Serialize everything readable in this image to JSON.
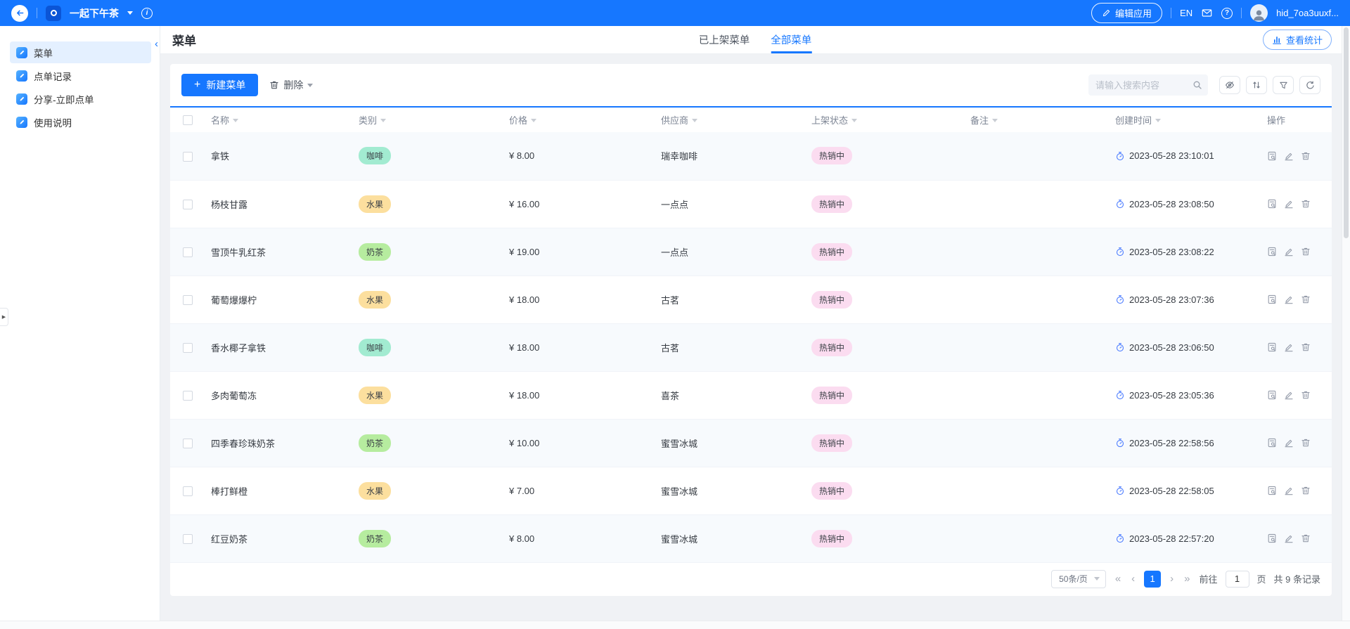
{
  "colors": {
    "primary": "#1677ff",
    "category": {
      "咖啡": "#a2ebd1",
      "水果": "#fcdf9e",
      "奶茶": "#b6ec9f"
    },
    "status": "#fbdcf0",
    "row_stripe": "#f7fafd"
  },
  "topbar": {
    "app_name": "一起下午茶",
    "edit_app_label": "编辑应用",
    "lang_label": "EN",
    "username": "hid_7oa3uuxf..."
  },
  "sidebar": {
    "items": [
      {
        "label": "菜单",
        "active": true
      },
      {
        "label": "点单记录",
        "active": false
      },
      {
        "label": "分享-立即点单",
        "active": false
      },
      {
        "label": "使用说明",
        "active": false
      }
    ]
  },
  "page": {
    "title": "菜单",
    "tabs": [
      {
        "label": "已上架菜单",
        "active": false
      },
      {
        "label": "全部菜单",
        "active": true
      }
    ],
    "stats_button": "查看统计"
  },
  "toolbar": {
    "new_button": "新建菜单",
    "delete_button": "删除",
    "search_placeholder": "请输入搜索内容"
  },
  "table": {
    "columns": [
      {
        "label": "名称",
        "sortable": true
      },
      {
        "label": "类别",
        "sortable": true
      },
      {
        "label": "价格",
        "sortable": true
      },
      {
        "label": "供应商",
        "sortable": true
      },
      {
        "label": "上架状态",
        "sortable": true
      },
      {
        "label": "备注",
        "sortable": true
      },
      {
        "label": "创建时间",
        "sortable": true
      },
      {
        "label": "操作",
        "sortable": false
      }
    ],
    "rows": [
      {
        "name": "拿铁",
        "category": "咖啡",
        "price": "¥ 8.00",
        "supplier": "瑞幸咖啡",
        "status": "热销中",
        "remark": "",
        "created": "2023-05-28 23:10:01"
      },
      {
        "name": "杨枝甘露",
        "category": "水果",
        "price": "¥ 16.00",
        "supplier": "一点点",
        "status": "热销中",
        "remark": "",
        "created": "2023-05-28 23:08:50"
      },
      {
        "name": "雪顶牛乳红茶",
        "category": "奶茶",
        "price": "¥ 19.00",
        "supplier": "一点点",
        "status": "热销中",
        "remark": "",
        "created": "2023-05-28 23:08:22"
      },
      {
        "name": "葡萄爆爆柠",
        "category": "水果",
        "price": "¥ 18.00",
        "supplier": "古茗",
        "status": "热销中",
        "remark": "",
        "created": "2023-05-28 23:07:36"
      },
      {
        "name": "香水椰子拿铁",
        "category": "咖啡",
        "price": "¥ 18.00",
        "supplier": "古茗",
        "status": "热销中",
        "remark": "",
        "created": "2023-05-28 23:06:50"
      },
      {
        "name": "多肉葡萄冻",
        "category": "水果",
        "price": "¥ 18.00",
        "supplier": "喜茶",
        "status": "热销中",
        "remark": "",
        "created": "2023-05-28 23:05:36"
      },
      {
        "name": "四季春珍珠奶茶",
        "category": "奶茶",
        "price": "¥ 10.00",
        "supplier": "蜜雪冰城",
        "status": "热销中",
        "remark": "",
        "created": "2023-05-28 22:58:56"
      },
      {
        "name": "棒打鲜橙",
        "category": "水果",
        "price": "¥ 7.00",
        "supplier": "蜜雪冰城",
        "status": "热销中",
        "remark": "",
        "created": "2023-05-28 22:58:05"
      },
      {
        "name": "红豆奶茶",
        "category": "奶茶",
        "price": "¥ 8.00",
        "supplier": "蜜雪冰城",
        "status": "热销中",
        "remark": "",
        "created": "2023-05-28 22:57:20"
      }
    ]
  },
  "pagination": {
    "page_size": "50条/页",
    "current_page": "1",
    "goto_label": "前往",
    "goto_value": "1",
    "page_label": "页",
    "total_label": "共 9 条记录"
  }
}
